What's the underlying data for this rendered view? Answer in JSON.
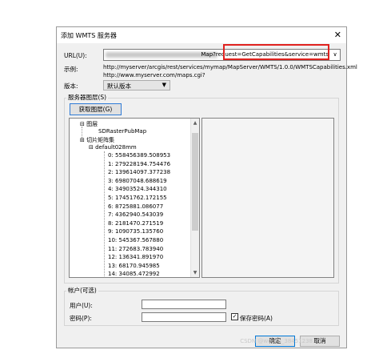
{
  "dialog": {
    "title": "添加 WMTS 服务器",
    "close_glyph": "✕"
  },
  "url": {
    "label": "URL(U):",
    "value_tail": "Map?request=GetCapabilities&service=wmts",
    "dropdown_glyph": "∨"
  },
  "example": {
    "label": "示例:",
    "line1": "http://myserver/arcgis/rest/services/mymap/MapServer/WMTS/1.0.0/WMTSCapabilities.xml",
    "line2": "http://www.myserver.com/maps.cgi?"
  },
  "version": {
    "label": "版本:",
    "selected": "默认版本",
    "arrow": "▼"
  },
  "layers_group": {
    "label": "服务器图层(S)",
    "get_button": "获取图层(G)"
  },
  "tree": {
    "layers_node": "图层",
    "layer_item": "SDRasterPubMap",
    "matrixset_node": "切片矩阵集",
    "matrixset_item": "default028mm",
    "levels": [
      "0: 558456389.508953",
      "1: 279228194.754476",
      "2: 139614097.377238",
      "3: 69807048.688619",
      "4: 34903524.344310",
      "5: 17451762.172155",
      "6: 8725881.086077",
      "7: 4362940.543039",
      "8: 2181470.271519",
      "9: 1090735.135760",
      "10: 545367.567880",
      "11: 272683.783940",
      "12: 136341.891970",
      "13: 68170.945985",
      "14: 34085.472992"
    ],
    "scroll_up": "▲",
    "scroll_down": "▼"
  },
  "account": {
    "label": "帐户(可选)",
    "user_label": "用户(U):",
    "password_label": "密码(P):",
    "save_password": "保存密码(A)",
    "save_checked": "✓"
  },
  "buttons": {
    "ok": "确定",
    "cancel": "取消"
  },
  "watermark": "CSDN @weixin_38451238"
}
